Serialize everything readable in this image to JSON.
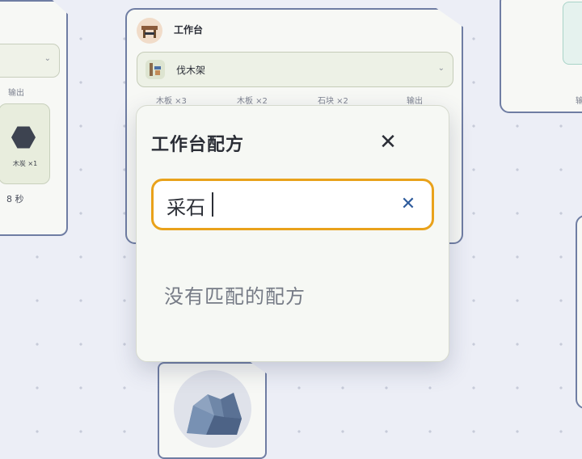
{
  "canvas": {
    "background": "#eceef6"
  },
  "left_card": {
    "output_label": "输出",
    "output_item": "木炭 ×1",
    "time": "8 秒",
    "output_icon": "hexagon-icon"
  },
  "workbench_card": {
    "title": "工作台",
    "icon": "workbench-icon",
    "recipe_select": {
      "value": "伐木架",
      "icon": "recipe-icon"
    },
    "io_labels": [
      "木板 ×3",
      "木板 ×2",
      "石块 ×2",
      "输出"
    ]
  },
  "right_card": {
    "fragment_text": "输"
  },
  "modal": {
    "title": "工作台配方",
    "search": {
      "value": "采石",
      "placeholder": ""
    },
    "empty_message": "没有匹配的配方",
    "accent": "#e9a21b"
  },
  "bottom_card": {
    "icon": "rock-icon"
  }
}
